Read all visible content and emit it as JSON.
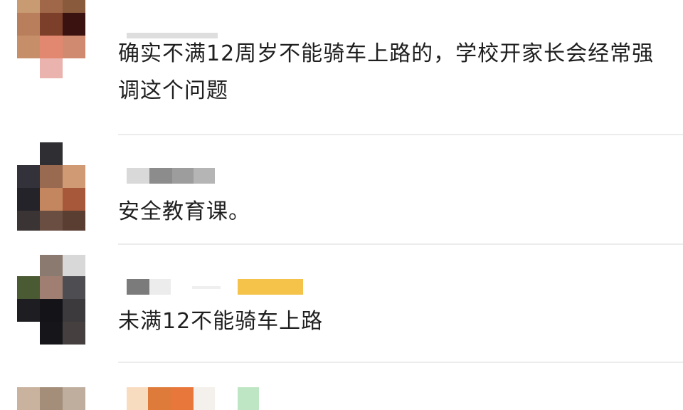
{
  "comments": [
    {
      "text": "确实不满12周岁不能骑车上路的，学校开家长会经常强调这个问题"
    },
    {
      "text": "安全教育课。"
    },
    {
      "text": "未满12不能骑车上路"
    },
    {
      "text": ""
    }
  ]
}
